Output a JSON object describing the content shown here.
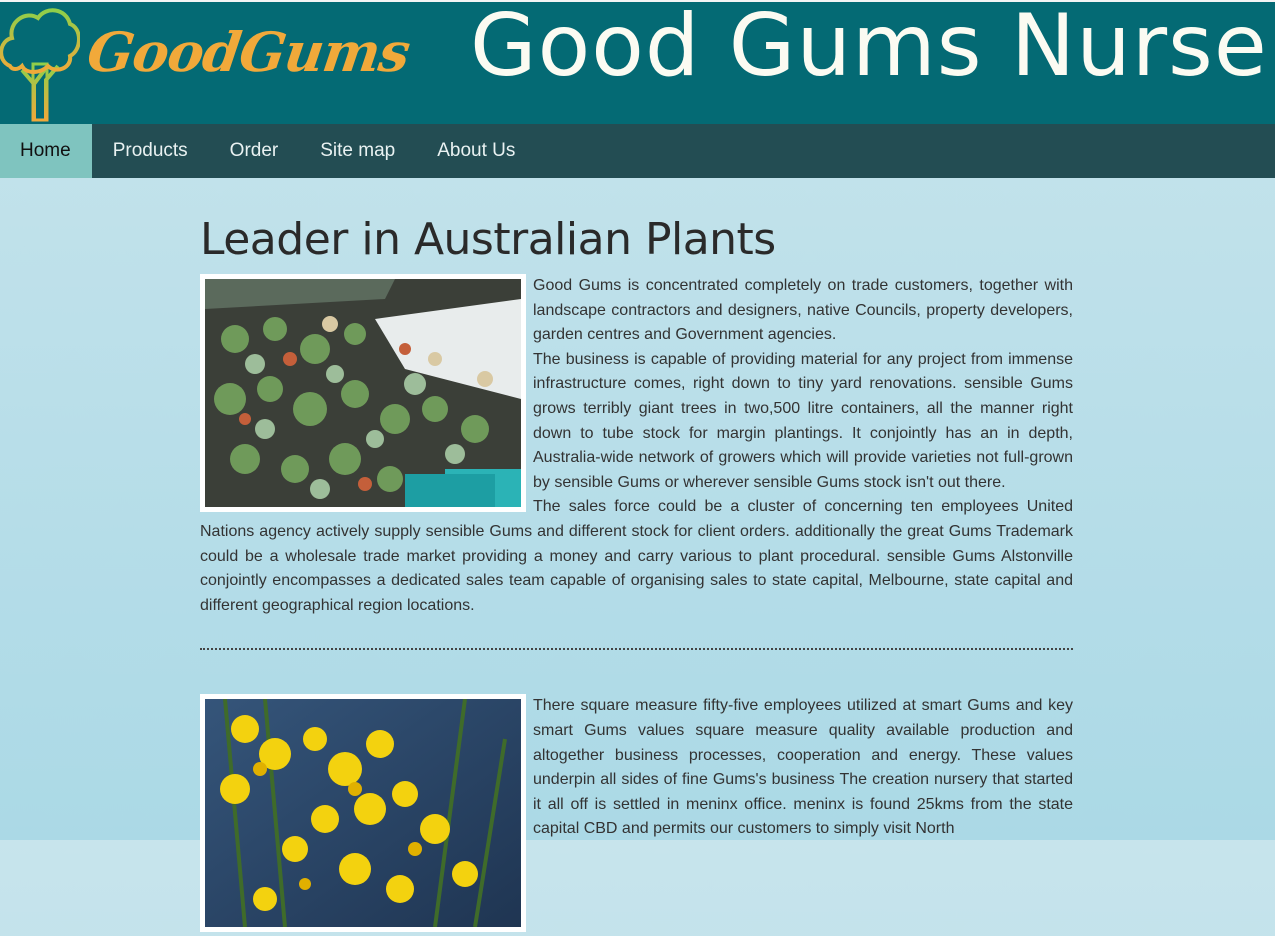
{
  "header": {
    "logo_text": "GoodGums",
    "site_title": "Good Gums Nursery"
  },
  "nav": {
    "items": [
      {
        "label": "Home",
        "active": true
      },
      {
        "label": "Products"
      },
      {
        "label": "Order"
      },
      {
        "label": "Site map"
      },
      {
        "label": "About Us"
      }
    ]
  },
  "main": {
    "heading": "Leader in Australian Plants",
    "section1": {
      "image": "succulents-photo",
      "paragraph1": "Good Gums is concentrated completely on trade customers, together with landscape contractors and designers, native Councils, property developers, garden centres and Government agencies.",
      "paragraph2": "The business is capable of providing material for any project from immense infrastructure comes, right down to tiny yard renovations. sensible Gums grows terribly giant trees in two,500 litre containers, all the manner right down to tube stock for margin plantings. It conjointly has an in depth, Australia-wide network of growers which will provide varieties not full-grown by sensible Gums or wherever sensible Gums stock isn't out there.",
      "paragraph3": "The sales force could be a cluster of concerning ten employees United Nations agency actively supply sensible Gums and different stock for client orders. additionally the great Gums Trademark could be a wholesale trade market providing a money and carry various to plant procedural. sensible Gums Alstonville conjointly encompasses a dedicated sales team capable of organising sales to state capital, Melbourne, state capital and different geographical region locations."
    },
    "section2": {
      "image": "wattle-flowers-photo",
      "paragraph1": "There square measure fifty-five employees utilized at smart Gums and key smart Gums values square measure quality available production and altogether business processes, cooperation and energy. These values underpin all sides of fine Gums's business The creation nursery that started it all off is settled in meninx office. meninx is found 25kms from the state capital CBD and permits our customers to simply visit North"
    }
  },
  "colors": {
    "header_bg": "#046a74",
    "nav_bg": "#234d53",
    "nav_active_bg": "#7fc4bf",
    "logo_orange": "#f1a93a",
    "title_text": "#fbfbf2"
  }
}
